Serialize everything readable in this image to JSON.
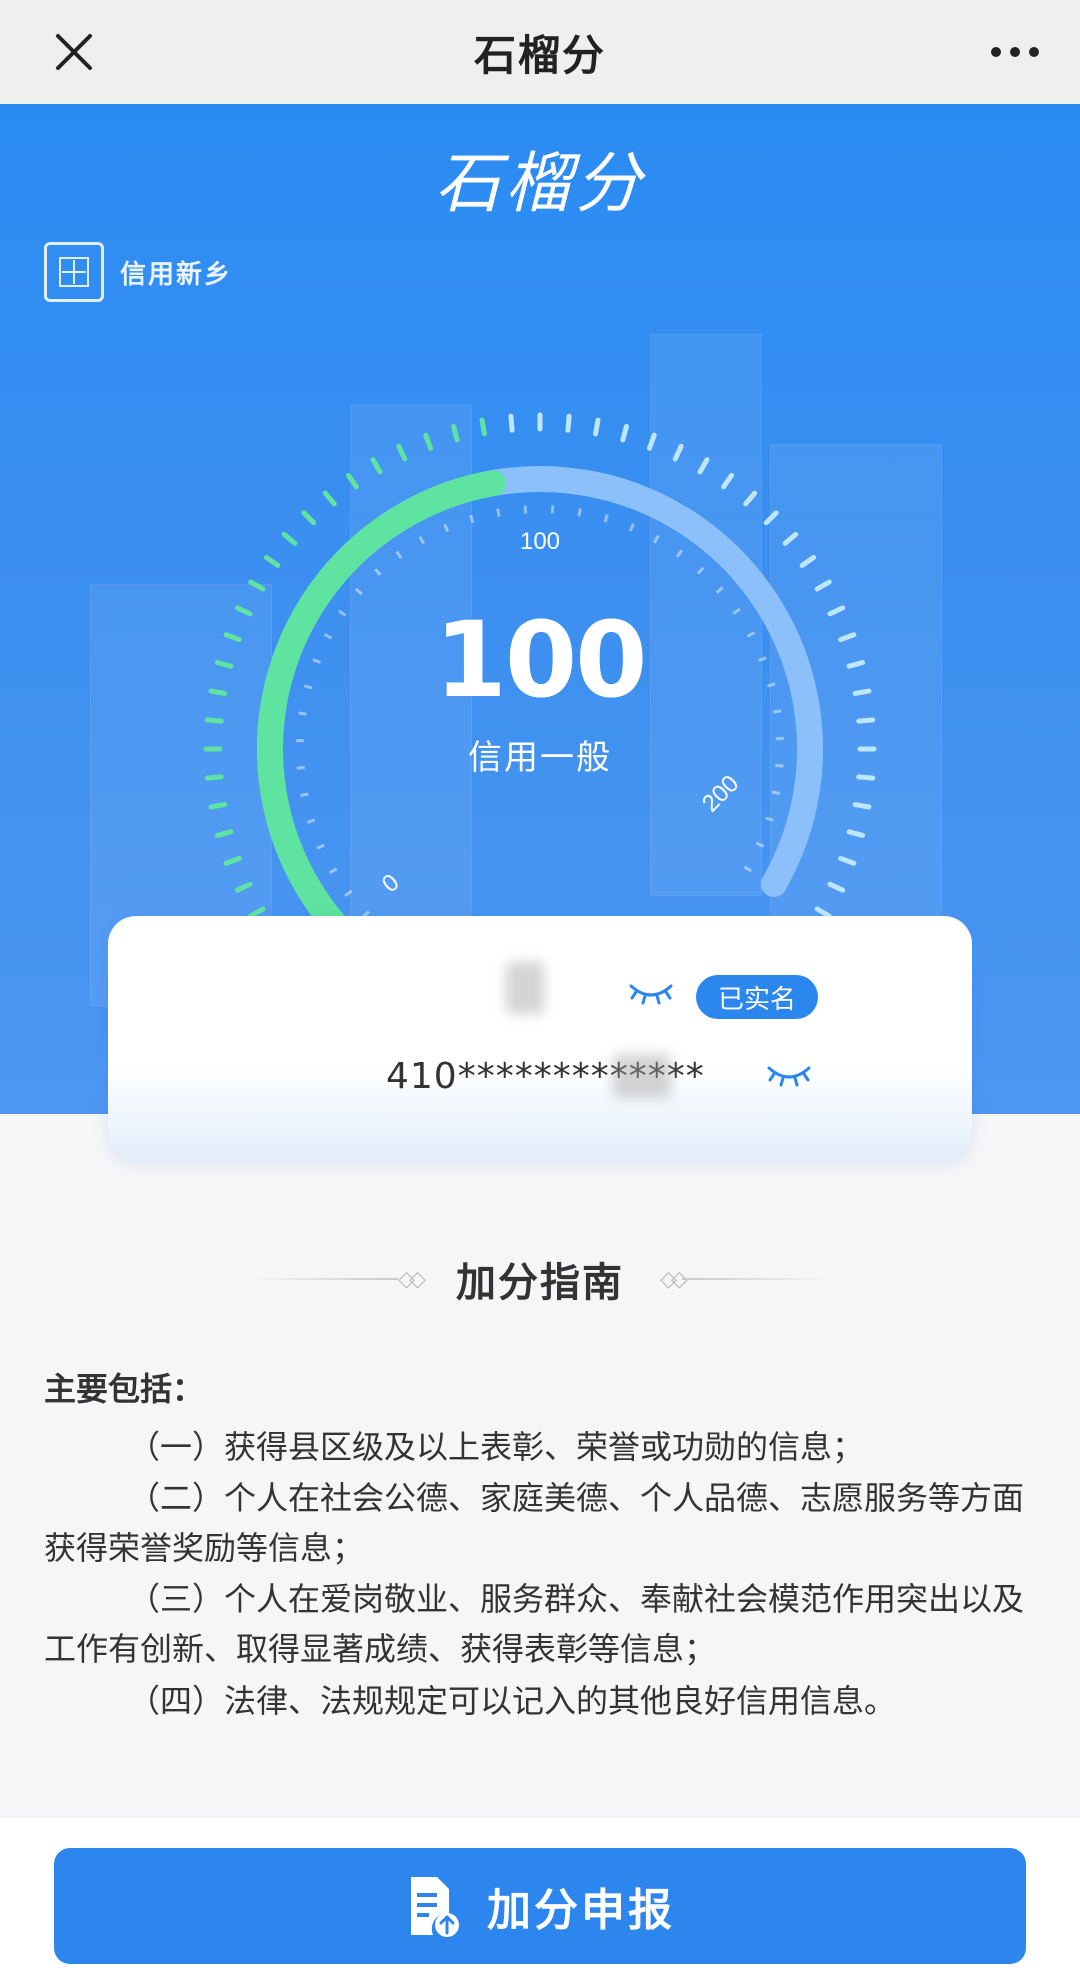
{
  "header": {
    "title": "石榴分",
    "close_icon": "close-icon",
    "more_icon": "more-icon"
  },
  "hero": {
    "logo_text": "石榴分",
    "brand_badge": "信用新乡",
    "gauge": {
      "min_label": "0",
      "mid_label": "100",
      "max_label": "200",
      "min": 0,
      "max": 200,
      "value": 100
    },
    "score": "100",
    "level": "信用一般",
    "colors": {
      "background": "#2a8cf3",
      "arc_active": "#5ee4a0",
      "arc_track": "#8cc0fb"
    }
  },
  "card": {
    "verified_label": "已实名",
    "id_number": "410*************",
    "eye_icon": "eye-closed-icon"
  },
  "guide": {
    "title": "加分指南",
    "heading": "主要包括：",
    "items": [
      "（一）获得县区级及以上表彰、荣誉或功勋的信息；",
      "（二）个人在社会公德、家庭美德、个人品德、志愿服务等方面获得荣誉奖励等信息；",
      "（三）个人在爱岗敬业、服务群众、奉献社会模范作用突出以及工作有创新、取得显著成绩、获得表彰等信息；",
      "（四）法律、法规规定可以记入的其他良好信用信息。"
    ]
  },
  "footer": {
    "apply_label": "加分申报",
    "apply_icon": "document-upload-icon"
  }
}
